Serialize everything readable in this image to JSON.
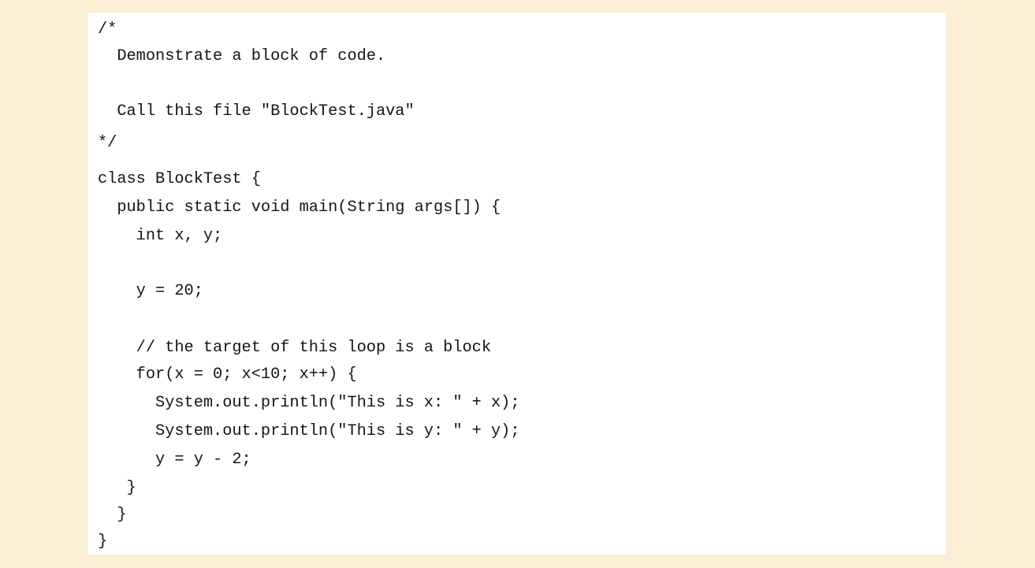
{
  "colors": {
    "page_background": "#faeed5",
    "panel_background": "#ffffff",
    "text": "#141414"
  },
  "code": {
    "language": "java",
    "lines": [
      "/*",
      "  Demonstrate a block of code.",
      "",
      "  Call this file \"BlockTest.java\"",
      "*/",
      "class BlockTest {",
      "  public static void main(String args[]) {",
      "    int x, y;",
      "",
      "    y = 20;",
      "",
      "    // the target of this loop is a block",
      "    for(x = 0; x<10; x++) {",
      "      System.out.println(\"This is x: \" + x);",
      "      System.out.println(\"This is y: \" + y);",
      "      y = y - 2;",
      "   }",
      "  }",
      "}"
    ]
  }
}
